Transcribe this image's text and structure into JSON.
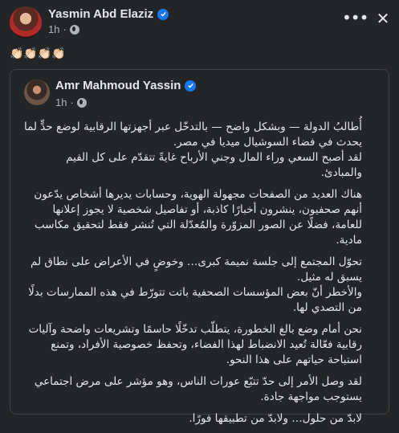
{
  "post": {
    "author": "Yasmin Abd Elaziz",
    "time": "1h",
    "caption": "👏🏻👏🏻👏🏻👏🏻"
  },
  "shared_post": {
    "author": "Amr Mahmoud Yassin",
    "time": "1h",
    "paragraphs": [
      "أُطالبُ الدولة — وبشكل واضح — بالتدخّل عبر أجهزتها الرقابية لوضع حدٍّ لما يحدث في فضاء السوشيال ميديا في مصر.\nلقد أصبح السعي وراء المال وجني الأرباح غايةً تتقدّم على كل القيم والمبادئ.",
      "هناك العديد من الصفحات مجهولة الهوية، وحسابات يديرها أشخاص يدّعون أنهم صحفيون، ينشرون أخبارًا كاذبة، أو تفاصيل شخصية لا يجوز إعلانها للعامة، فضلًا عن الصور المزوّرة والمُعدّلة التي تُنشر فقط لتحقيق مكاسب مادية.",
      "تحوّل المجتمع إلى جلسة نميمة كبرى… وخوضٍ في الأعراض على نطاق لم يسبق له مثيل.\nوالأخطر أنّ بعض المؤسسات الصحفية باتت تتورّط في هذه الممارسات بدلًا من التصدي لها.",
      "نحن أمام وضع بالغ الخطورة، يتطلّب تدخّلًا حاسمًا وتشريعات واضحة وآليات رقابية فعّالة تُعيد الانضباط لهذا الفضاء، وتحفظ خصوصية الأفراد، وتمنع استباحة حياتهم على هذا النحو.",
      "لقد وصل الأمر إلى حدّ تتبّع عورات الناس، وهو مؤشر على مرض اجتماعي يستوجب مواجهة جادة.",
      "لابدّ من حلول… ولابدّ من تطبيقها فورًا."
    ]
  },
  "icons": {
    "more": "more-horizontal-icon",
    "close": "close-icon",
    "verified": "verified-badge-icon",
    "audience": "globe-icon"
  },
  "colors": {
    "background": "#242526",
    "text": "#e4e6eb",
    "secondary_text": "#b0b3b8",
    "verified": "#1877f2",
    "border": "#3e4042"
  }
}
